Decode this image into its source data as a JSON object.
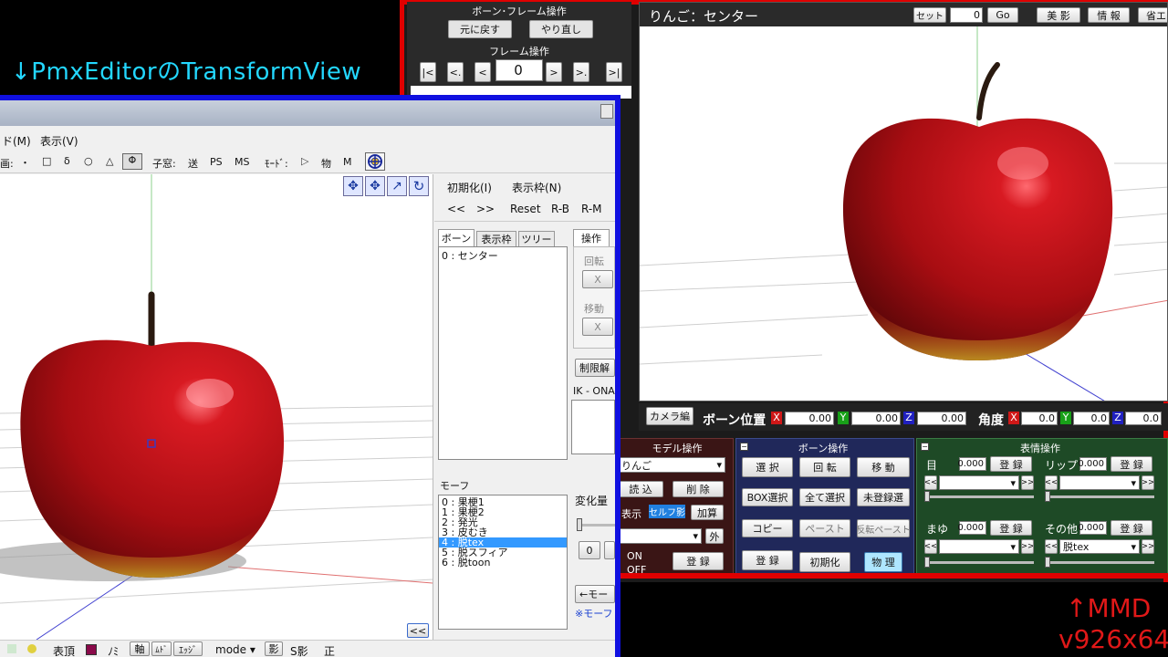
{
  "caption_top": "↓PmxEditorのTransformView",
  "caption_bottom_line1": "↑MMD",
  "caption_bottom_line2": "v926x64",
  "colors": {
    "accent_cyan": "#23d7ff",
    "frame_red": "#e00000",
    "frame_blue": "#1010e0",
    "apple_red": "#b50d12",
    "panel_green": "#1e4a26",
    "panel_navy": "#20285a",
    "panel_maroon": "#3a1515"
  },
  "mmd": {
    "bone_frame_title": "ボーン･フレーム操作",
    "undo": "元に戻す",
    "redo": "やり直し",
    "frame_op_title": "フレーム操作",
    "frame_value": "0",
    "frame_nav": [
      "|<",
      "<.",
      "<",
      ">",
      ">.",
      ">|"
    ],
    "viewport_title": "りんご：センター",
    "set_label": "セット",
    "set_value": "0",
    "go_label": "Go",
    "bishadow_label": "美 影",
    "info_label": "情 報",
    "save_label": "省エ",
    "camera_edit": "カメラ編",
    "bone_pos_label": "ボーン位置",
    "pos": {
      "x": "0.00",
      "y": "0.00",
      "z": "0.00"
    },
    "angle_label": "角度",
    "angle": {
      "x": "0.0",
      "y": "0.0",
      "z": "0.0"
    },
    "axis_x": "X",
    "axis_y": "Y",
    "axis_z": "Z",
    "model_panel": {
      "title": "モデル操作",
      "model_name": "りんご",
      "load": "読 込",
      "delete": "削 除",
      "display": "表示",
      "self_shadow": "セルフ影",
      "add": "加算",
      "outer": "外",
      "on": "ON",
      "off": "OFF",
      "register": "登 録"
    },
    "bone_panel": {
      "title": "ボーン操作",
      "select": "選 択",
      "rotate": "回 転",
      "move": "移 動",
      "box_select": "BOX選択",
      "select_all": "全て選択",
      "unregistered": "未登録選",
      "copy": "コピー",
      "paste": "ペースト",
      "flip_paste": "反転ペースト",
      "register": "登 録",
      "reset": "初期化",
      "physics": "物 理"
    },
    "morph_panel": {
      "title": "表情操作",
      "eye": "目",
      "eye_value": "0.000",
      "lip": "リップ",
      "lip_value": "0.000",
      "brow": "まゆ",
      "brow_value": "0.000",
      "other": "その他",
      "other_value": "0.000",
      "other_selected": "脱tex",
      "register": "登 録"
    }
  },
  "pmx": {
    "menu": [
      "ド(M)",
      "表示(V)"
    ],
    "toolbar_label": "画:",
    "toolbar_symbols": [
      "・",
      "□",
      "δ",
      "○",
      "△",
      "Φ"
    ],
    "child_label": "子窓:",
    "child_items": [
      "送",
      "PS",
      "MS"
    ],
    "mode_label": "ﾓｰﾄﾞ:",
    "mode_items": [
      "▷",
      "物",
      "M"
    ],
    "side_menu": [
      "初期化(I)",
      "表示枠(N)"
    ],
    "nav_buttons": [
      "<<",
      ">>",
      "Reset",
      "R-B",
      "R-M"
    ],
    "tabs": [
      "ボーン",
      "表示枠",
      "ツリー"
    ],
    "bone_list": [
      "0 : センター"
    ],
    "ops_tab": "操作",
    "rotate_label": "回転",
    "move_label": "移動",
    "x_button": "X",
    "limit_button": "制限解",
    "ik_label": "IK - ONA",
    "morph_label": "モーフ",
    "morph_list": [
      "0 : 果梗1",
      "1 : 果梗2",
      "2 : 発光",
      "3 : 皮むき",
      "4 : 脱tex",
      "5 : 脱スフィア",
      "6 : 脱toon"
    ],
    "morph_selected_index": 4,
    "change_label": "変化量",
    "zero_button": "0",
    "arrow_button": "←モー",
    "note": "※モーフ",
    "collapse": "<<",
    "bottom_bar": [
      "表頂",
      "ﾉﾐ",
      "軸",
      "ﾑﾄﾞ",
      "ｴｯｼﾞ",
      "mode ▾",
      "影",
      "S影",
      "正"
    ]
  }
}
